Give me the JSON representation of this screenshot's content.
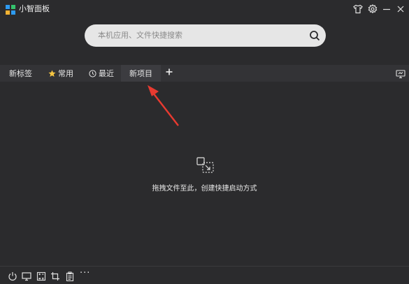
{
  "app": {
    "title": "小智面板"
  },
  "search": {
    "placeholder": "本机应用、文件快捷搜索"
  },
  "tabs": [
    {
      "label": "新标签",
      "icon": "none"
    },
    {
      "label": "常用",
      "icon": "star-icon"
    },
    {
      "label": "最近",
      "icon": "clock-icon"
    },
    {
      "label": "新项目",
      "icon": "none",
      "active": true
    }
  ],
  "empty_state": {
    "text": "拖拽文件至此，创建快捷启动方式"
  },
  "colors": {
    "background": "#2b2b2d",
    "tabbar": "#333336",
    "active_tab": "#3c3c40",
    "search_bg": "#e6e6e6",
    "arrow": "#e83a30",
    "star": "#f5c542"
  },
  "bottom_toolbar": [
    "power-icon",
    "desktop-icon",
    "calculator-icon",
    "crop-icon",
    "clipboard-icon",
    "more-icon"
  ]
}
